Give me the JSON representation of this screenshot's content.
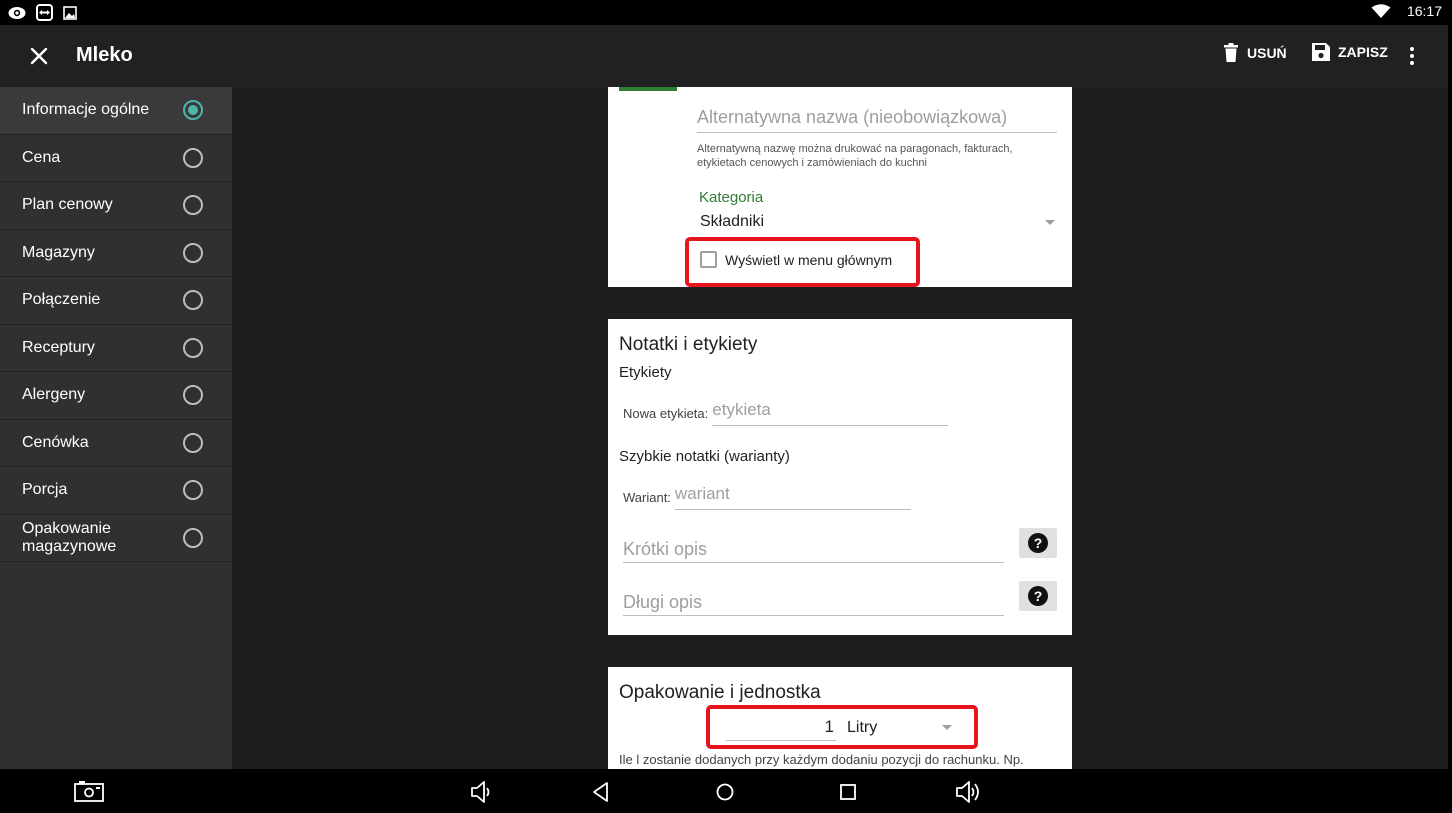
{
  "status_bar": {
    "time": "16:17",
    "icons": [
      "eye-icon",
      "teamviewer-icon",
      "image-icon",
      "wifi-icon"
    ]
  },
  "app_bar": {
    "title": "Mleko",
    "delete_label": "USUŃ",
    "save_label": "ZAPISZ"
  },
  "sidebar": {
    "items": [
      {
        "label": "Informacje ogólne",
        "selected": true
      },
      {
        "label": "Cena",
        "selected": false
      },
      {
        "label": "Plan cenowy",
        "selected": false
      },
      {
        "label": "Magazyny",
        "selected": false
      },
      {
        "label": "Połączenie",
        "selected": false
      },
      {
        "label": "Receptury",
        "selected": false
      },
      {
        "label": "Alergeny",
        "selected": false
      },
      {
        "label": "Cenówka",
        "selected": false
      },
      {
        "label": "Porcja",
        "selected": false
      },
      {
        "label": "Opakowanie magazynowe",
        "selected": false
      }
    ]
  },
  "general_card": {
    "alt_name_placeholder": "Alternatywna nazwa (nieobowiązkowa)",
    "alt_name_hint": "Alternatywną nazwę można drukować na paragonach, fakturach, etykietach cenowych i zamówieniach do kuchni",
    "category_label": "Kategoria",
    "category_value": "Składniki",
    "show_in_main_menu_label": "Wyświetl w menu głównym",
    "show_in_main_menu_checked": false
  },
  "notes_card": {
    "title": "Notatki i etykiety",
    "labels_heading": "Etykiety",
    "new_label_label": "Nowa etykieta:",
    "new_label_placeholder": "etykieta",
    "quick_notes_heading": "Szybkie notatki (warianty)",
    "variant_label": "Wariant:",
    "variant_placeholder": "wariant",
    "short_desc_placeholder": "Krótki opis",
    "long_desc_placeholder": "Długi opis",
    "help_symbol": "?"
  },
  "packaging_card": {
    "title": "Opakowanie i jednostka",
    "quantity": "1",
    "unit": "Litry",
    "description": "Ile l zostanie dodanych przy każdym dodaniu pozycji do rachunku. Np."
  },
  "colors": {
    "accent_green": "#2e7d32",
    "radio_selected": "#4db6ac",
    "highlight_red": "#e8141d",
    "app_bar_bg": "#212121",
    "sidebar_bg": "#303030"
  }
}
